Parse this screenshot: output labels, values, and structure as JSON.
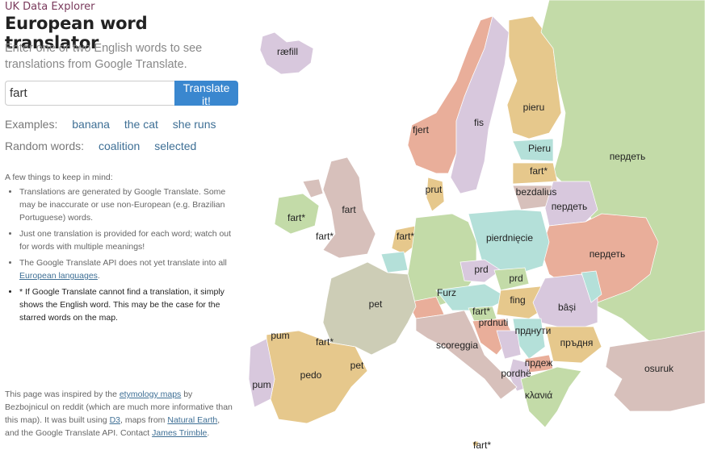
{
  "brand": "UK Data Explorer",
  "title": "European word translator",
  "subtitle": "Enter one or two English words to see translations from Google Translate.",
  "search": {
    "value": "fart",
    "button_label": "Translate it!"
  },
  "examples": {
    "label": "Examples:",
    "items": [
      "banana",
      "the cat",
      "she runs"
    ]
  },
  "random": {
    "label": "Random words:",
    "items": [
      "coalition",
      "selected"
    ]
  },
  "notes": {
    "heading": "A few things to keep in mind:",
    "item1": "Translations are generated by Google Translate. Some may be inaccurate or use non-European (e.g. Brazilian Portuguese) words.",
    "item2": "Just one translation is provided for each word; watch out for words with multiple meanings!",
    "item3_text": "The Google Translate API does not yet translate into all",
    "item3_link": "European languages",
    "item3_end": ".",
    "item4": "* If Google Translate cannot find a translation, it simply shows the English word. This may be the case for the starred words on the map."
  },
  "footer": {
    "t1": "This page was inspired by the",
    "link_etym": "etymology maps",
    "t2": "by Bezbojnicul on reddit (which are much more informative than this map). It was built using",
    "link_d3": "D3",
    "t3": ", maps from",
    "link_ne": "Natural Earth",
    "t4": ", and the Google Translate API. Contact",
    "link_author": "James Trimble",
    "t5": "."
  },
  "colors": {
    "pink": "#e9ae9a",
    "lilac": "#d8c8dd",
    "tan": "#e6c88c",
    "green": "#c3dba8",
    "teal": "#b4e0d9",
    "rose": "#d7c0bb",
    "grey": "#cdcdb6",
    "accent": "#3a87cf"
  },
  "map": {
    "countries": [
      {
        "name": "Iceland",
        "word": "ræfill",
        "color": "lilac"
      },
      {
        "name": "Norway",
        "word": "fjert",
        "color": "pink"
      },
      {
        "name": "Sweden",
        "word": "fis",
        "color": "lilac"
      },
      {
        "name": "Finland",
        "word": "pieru",
        "color": "tan"
      },
      {
        "name": "Russia",
        "word": "пердеть",
        "color": "green"
      },
      {
        "name": "Estonia",
        "word": "Pieru",
        "color": "teal"
      },
      {
        "name": "Latvia",
        "word": "fart*",
        "color": "tan"
      },
      {
        "name": "Lithuania",
        "word": "bezdalius",
        "color": "rose"
      },
      {
        "name": "Belarus",
        "word": "пердеть",
        "color": "lilac"
      },
      {
        "name": "Ukraine",
        "word": "пердеть",
        "color": "pink"
      },
      {
        "name": "Ireland",
        "word": "fart*",
        "color": "green"
      },
      {
        "name": "Northern Ireland",
        "word": "fart*",
        "color": "rose"
      },
      {
        "name": "United Kingdom",
        "word": "fart",
        "color": "rose"
      },
      {
        "name": "Denmark",
        "word": "prut",
        "color": "tan"
      },
      {
        "name": "Netherlands",
        "word": "fart*",
        "color": "tan"
      },
      {
        "name": "Belgium",
        "word": "",
        "color": "teal"
      },
      {
        "name": "Germany",
        "word": "Furz",
        "color": "green"
      },
      {
        "name": "Poland",
        "word": "pierdnięcie",
        "color": "teal"
      },
      {
        "name": "Czech Republic",
        "word": "prd",
        "color": "lilac"
      },
      {
        "name": "Slovakia",
        "word": "prd",
        "color": "green"
      },
      {
        "name": "Austria",
        "word": "",
        "color": "teal"
      },
      {
        "name": "Switzerland",
        "word": "",
        "color": "pink"
      },
      {
        "name": "Hungary",
        "word": "fing",
        "color": "tan"
      },
      {
        "name": "Slovenia",
        "word": "fart*",
        "color": "green"
      },
      {
        "name": "Croatia",
        "word": "prdnuti",
        "color": "pink"
      },
      {
        "name": "Romania",
        "word": "bâși",
        "color": "lilac"
      },
      {
        "name": "Moldova",
        "word": "",
        "color": "teal"
      },
      {
        "name": "Serbia",
        "word": "прднути",
        "color": "teal"
      },
      {
        "name": "Bosnia",
        "word": "",
        "color": "lilac"
      },
      {
        "name": "Bulgaria",
        "word": "пръдня",
        "color": "tan"
      },
      {
        "name": "Macedonia",
        "word": "прдеж",
        "color": "pink"
      },
      {
        "name": "Albania",
        "word": "pordhë",
        "color": "lilac"
      },
      {
        "name": "Greece",
        "word": "κλανιά",
        "color": "green"
      },
      {
        "name": "Turkey",
        "word": "osuruk",
        "color": "rose"
      },
      {
        "name": "France",
        "word": "pet",
        "color": "grey"
      },
      {
        "name": "Italy",
        "word": "scoreggia",
        "color": "rose"
      },
      {
        "name": "Spain",
        "word": "pedo",
        "color": "tan"
      },
      {
        "name": "Galicia",
        "word": "pum",
        "color": "tan"
      },
      {
        "name": "Basque",
        "word": "fart*",
        "color": "tan"
      },
      {
        "name": "Catalonia",
        "word": "pet",
        "color": "tan"
      },
      {
        "name": "Portugal",
        "word": "pum",
        "color": "lilac"
      },
      {
        "name": "Malta",
        "word": "fart*",
        "color": "tan"
      }
    ]
  }
}
